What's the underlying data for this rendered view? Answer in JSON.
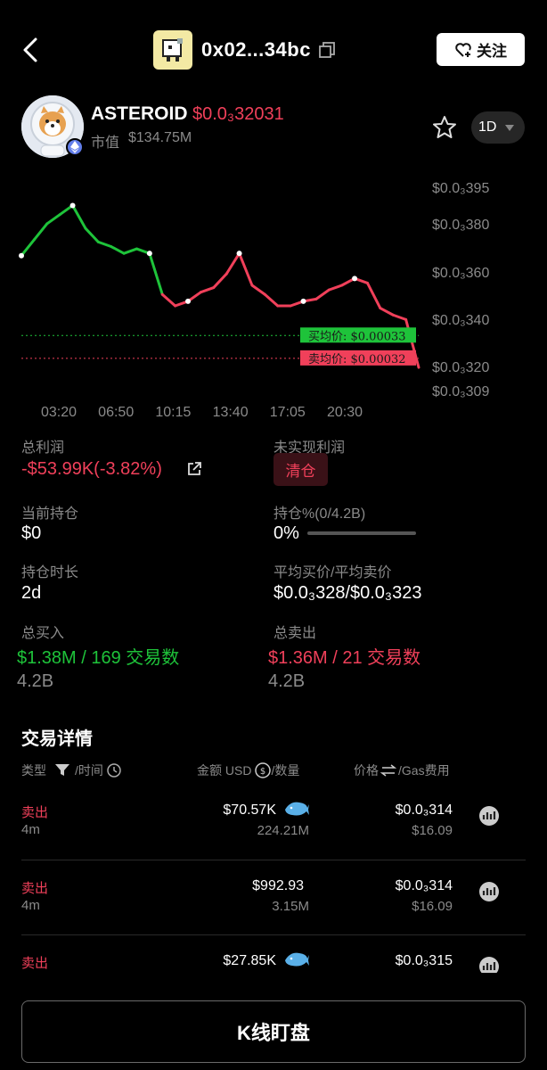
{
  "header": {
    "token_address": "0x02...34bc",
    "follow_label": "关注"
  },
  "token": {
    "name": "ASTEROID",
    "price": "$0.0₃32031",
    "market_cap_label": "市值",
    "market_cap": "$134.75M",
    "timeframe": "1D"
  },
  "chart": {
    "y_ticks": [
      "$0.0₃395",
      "$0.0₃380",
      "$0.0₃360",
      "$0.0₃340",
      "$0.0₃320",
      "$0.0₃309"
    ],
    "x_ticks": [
      "03:20",
      "06:50",
      "10:15",
      "13:40",
      "17:05",
      "20:30"
    ],
    "avg_buy_tag": "买均价: $0.00033",
    "avg_sell_tag": "卖均价: $0.00032"
  },
  "chart_data": {
    "type": "line",
    "ylim": [
      0.000309,
      0.000395
    ],
    "x": [
      "03:20",
      "06:50",
      "10:15",
      "13:40",
      "17:05",
      "20:30"
    ],
    "series": [
      {
        "values": [
          0.000365,
          0.000372,
          0.000379,
          0.000383,
          0.000387,
          0.000377,
          0.000371,
          0.000369,
          0.000366,
          0.000368,
          0.000366,
          0.000348,
          0.000343,
          0.000345,
          0.000349,
          0.000351,
          0.000357,
          0.000366,
          0.000352,
          0.000348,
          0.000343,
          0.000343,
          0.000345,
          0.000346,
          0.00035,
          0.000352,
          0.000355,
          0.000353,
          0.000342,
          0.000339,
          0.000337,
          0.000316
        ]
      }
    ],
    "reference_lines": [
      {
        "name": "买均价",
        "value": 0.00033
      },
      {
        "name": "卖均价",
        "value": 0.00032
      }
    ]
  },
  "stats": {
    "total_profit_label": "总利润",
    "total_profit": "-$53.99K(-3.82%)",
    "unrealized_label": "未实现利润",
    "clear_label": "清仓",
    "holding_label": "当前持仓",
    "holding": "$0",
    "holding_pct_label": "持仓%(0/4.2B)",
    "holding_pct": "0%",
    "holding_pct_value": 0,
    "duration_label": "持仓时长",
    "duration": "2d",
    "avg_price_label": "平均买价/平均卖价",
    "avg_price": "$0.0₃328/$0.0₃323",
    "total_buy_label": "总买入",
    "total_buy": "$1.38M / 169 交易数",
    "total_buy_qty": "4.2B",
    "total_sell_label": "总卖出",
    "total_sell": "$1.36M / 21 交易数",
    "total_sell_qty": "4.2B"
  },
  "trades": {
    "title": "交易详情",
    "col_type": "类型",
    "col_time": "/时间",
    "col_amount": "金额 USD",
    "col_qty": "/数量",
    "col_price": "价格",
    "col_gas": "/Gas费用",
    "rows": [
      {
        "side": "卖出",
        "age": "4m",
        "amount": "$70.57K",
        "qty": "224.21M",
        "price": "$0.0₃314",
        "gas": "$16.09",
        "whale": true
      },
      {
        "side": "卖出",
        "age": "4m",
        "amount": "$992.93",
        "qty": "3.15M",
        "price": "$0.0₃314",
        "gas": "$16.09",
        "whale": false
      },
      {
        "side": "卖出",
        "age": "",
        "amount": "$27.85K",
        "qty": "",
        "price": "$0.0₃315",
        "gas": "",
        "whale": true
      }
    ]
  },
  "footer": {
    "kline_label": "K线盯盘"
  },
  "colors": {
    "up": "#1ec33a",
    "down": "#f0405a",
    "background": "#000000"
  }
}
